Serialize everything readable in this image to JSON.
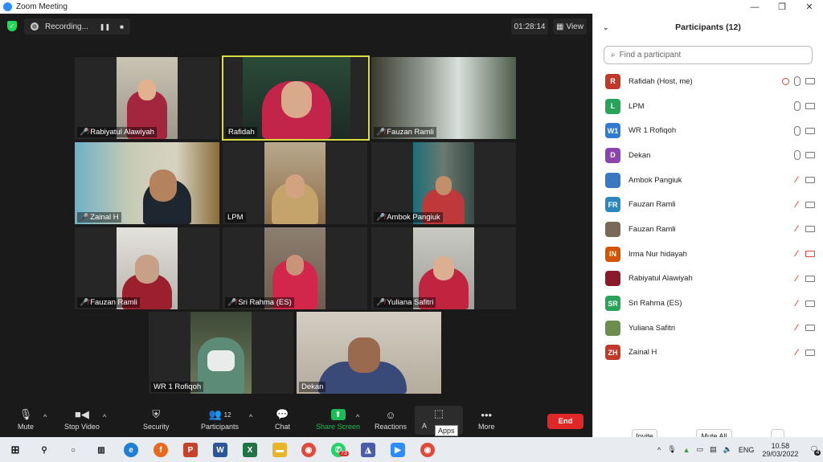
{
  "window": {
    "title": "Zoom Meeting"
  },
  "meeting": {
    "recording_label": "Recording...",
    "timer": "01:28:14",
    "view_label": "View"
  },
  "tiles": [
    {
      "name": "Rabiyatul Alawiyah",
      "muted": true
    },
    {
      "name": "Rafidah",
      "muted": false
    },
    {
      "name": "Fauzan Ramli",
      "muted": true
    },
    {
      "name": "Zainal H",
      "muted": true
    },
    {
      "name": "LPM",
      "muted": false
    },
    {
      "name": "Ambok Pangiuk",
      "muted": true
    },
    {
      "name": "Fauzan Ramli",
      "muted": true
    },
    {
      "name": "Sri Rahma (ES)",
      "muted": true
    },
    {
      "name": "Yuliana Safitri",
      "muted": true
    },
    {
      "name": "WR 1 Rofiqoh",
      "muted": false
    },
    {
      "name": "Dekan",
      "muted": false
    }
  ],
  "toolbar": {
    "mute": "Mute",
    "stop_video": "Stop Video",
    "security": "Security",
    "participants": "Participants",
    "participants_count": "12",
    "chat": "Chat",
    "share_screen": "Share Screen",
    "reactions": "Reactions",
    "apps": "Apps",
    "apps_partial": "A",
    "more": "More",
    "end": "End",
    "tooltip": "Apps"
  },
  "panel": {
    "title": "Participants (12)",
    "search_placeholder": "Find a participant",
    "participants": [
      {
        "initials": "R",
        "name": "Rafidah (Host, me)",
        "color": "#c0392b",
        "mic": "on",
        "recording": true
      },
      {
        "initials": "L",
        "name": "LPM",
        "color": "#27a35a",
        "mic": "on"
      },
      {
        "initials": "W1",
        "name": "WR 1 Rofiqoh",
        "color": "#2e7bcf",
        "mic": "on"
      },
      {
        "initials": "D",
        "name": "Dekan",
        "color": "#8e44ad",
        "mic": "on"
      },
      {
        "initials": "",
        "name": "Ambok Pangiuk",
        "color": "#3a78c2",
        "mic": "off"
      },
      {
        "initials": "FR",
        "name": "Fauzan Ramli",
        "color": "#2e86c1",
        "mic": "off"
      },
      {
        "initials": "",
        "name": "Fauzan Ramli",
        "color": "#7a6a55",
        "mic": "off"
      },
      {
        "initials": "IN",
        "name": "Irma Nur hidayah",
        "color": "#d35400",
        "mic": "off",
        "cam_off": true
      },
      {
        "initials": "",
        "name": "Rabiyatul Alawiyah",
        "color": "#8b1a2b",
        "mic": "off"
      },
      {
        "initials": "SR",
        "name": "Sri Rahma (ES)",
        "color": "#27a35a",
        "mic": "off"
      },
      {
        "initials": "",
        "name": "Yuliana Safitri",
        "color": "#6b8e4e",
        "mic": "off"
      },
      {
        "initials": "ZH",
        "name": "Zainal H",
        "color": "#c0392b",
        "mic": "off"
      }
    ],
    "invite": "Invite",
    "mute_all": "Mute All",
    "more": "..."
  },
  "taskbar": {
    "lang": "ENG",
    "time": "10.58",
    "date": "29/03/2022",
    "whatsapp_badge": "73",
    "notifications": "4"
  }
}
